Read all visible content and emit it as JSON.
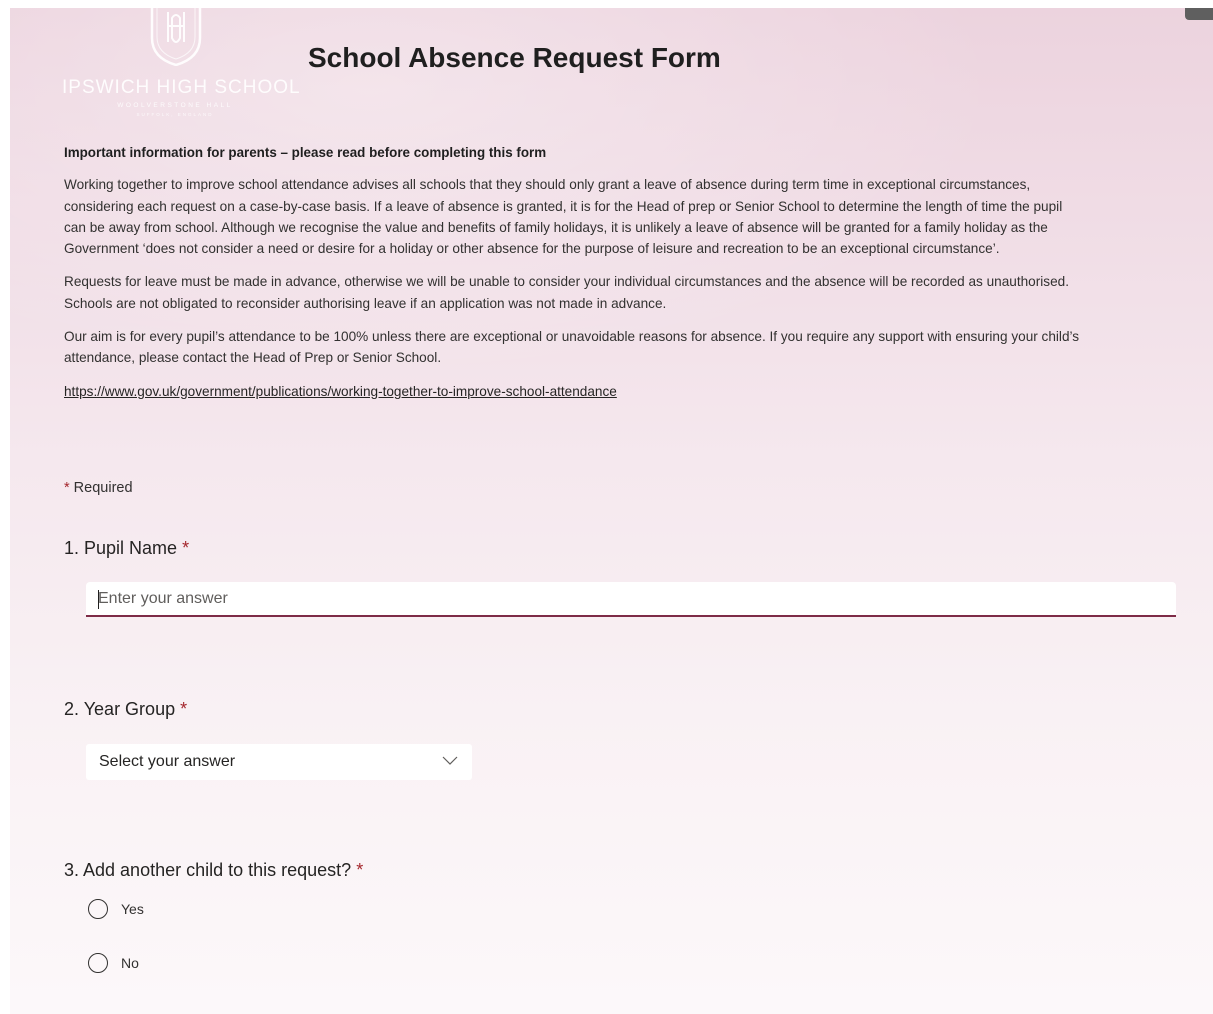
{
  "header": {
    "school_name": "IPSWICH HIGH SCHOOL",
    "school_subtitle": "WOOLVERSTONE HALL",
    "school_location": "SUFFOLK, ENGLAND",
    "form_title": "School Absence Request Form"
  },
  "description": {
    "heading": "Important information for parents – please read before completing this form",
    "paragraphs": [
      "Working together to improve school attendance advises all schools that they should only grant a leave of absence during term time in exceptional circumstances,\nconsidering each request on a case-by-case basis. If a leave of absence is granted, it is for the Head of prep or Senior School to determine the length of time the pupil\ncan be away from school. Although we recognise the value and benefits of family holidays, it is unlikely a leave of absence will be granted for a family holiday as the\nGovernment ‘does not consider a need or desire for a holiday or other absence for the purpose of leisure and recreation to be an exceptional circumstance’.",
      "Requests for leave must be made in advance, otherwise we will be unable to consider your individual circumstances and the absence will be recorded as unauthorised.\nSchools are not obligated to reconsider authorising leave if an application was not made in advance.",
      "Our aim is for every pupil’s attendance to be 100% unless there are exceptional or unavoidable reasons for absence. If you require any support with ensuring your child’s\nattendance, please contact the Head of Prep or Senior School."
    ],
    "link": "https://www.gov.uk/government/publications/working-together-to-improve-school-attendance"
  },
  "required_note": {
    "star": "*",
    "text": " Required"
  },
  "questions": {
    "q1": {
      "title": "1. Pupil Name ",
      "star": "*",
      "placeholder": "Enter your answer",
      "value": ""
    },
    "q2": {
      "title": "2. Year Group ",
      "star": "*",
      "selected": "Select your answer"
    },
    "q3": {
      "title": "3. Add another child to this request? ",
      "star": "*",
      "options": [
        "Yes",
        "No"
      ]
    }
  },
  "colors": {
    "accent": "#7e2b47",
    "required_star": "#a4262c",
    "background_top": "#ecd3de",
    "background_bottom": "#fcf8fa"
  },
  "icons": {
    "crest": "school-crest-icon",
    "dropdown": "chevron-down-icon",
    "radio": "radio-empty-icon"
  }
}
